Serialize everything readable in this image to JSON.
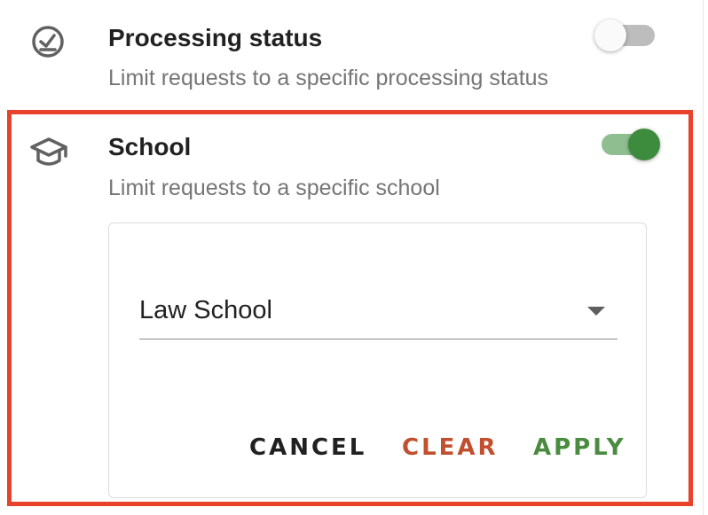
{
  "processing_status": {
    "title": "Processing status",
    "subtitle": "Limit requests to a specific processing status",
    "icon": "check-circle-icon",
    "enabled": false
  },
  "school": {
    "title": "School",
    "subtitle": "Limit requests to a specific school",
    "icon": "graduation-cap-icon",
    "enabled": true,
    "select_value": "Law School"
  },
  "actions": {
    "cancel_label": "CANCEL",
    "clear_label": "CLEAR",
    "apply_label": "APPLY"
  },
  "colors": {
    "highlight": "#e8412c",
    "toggle_on": "#3d8b3d",
    "clear": "#c0502f",
    "apply": "#4a8c3f",
    "cancel": "#212121"
  }
}
